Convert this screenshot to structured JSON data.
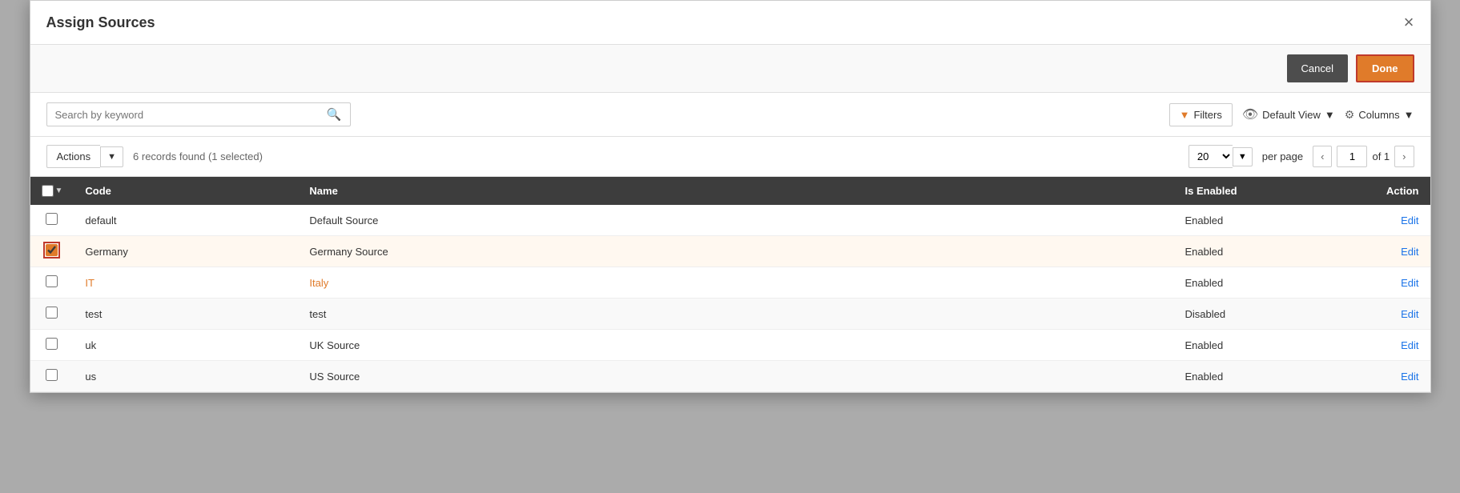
{
  "modal": {
    "title": "Assign Sources",
    "close_label": "×"
  },
  "toolbar": {
    "cancel_label": "Cancel",
    "done_label": "Done"
  },
  "search": {
    "placeholder": "Search by keyword"
  },
  "filter_bar": {
    "filters_label": "Filters",
    "view_label": "Default View",
    "columns_label": "Columns"
  },
  "actions_bar": {
    "actions_label": "Actions",
    "records_info": "6 records found (1 selected)",
    "per_page_value": "20",
    "per_page_label": "per page",
    "page_current": "1",
    "page_of": "of 1"
  },
  "table": {
    "headers": [
      "Code",
      "Name",
      "Is Enabled",
      "Action"
    ],
    "rows": [
      {
        "code": "default",
        "name": "Default Source",
        "is_enabled": "Enabled",
        "action": "Edit",
        "checked": false,
        "code_link": false
      },
      {
        "code": "Germany",
        "name": "Germany Source",
        "is_enabled": "Enabled",
        "action": "Edit",
        "checked": true,
        "code_link": false
      },
      {
        "code": "IT",
        "name": "Italy",
        "is_enabled": "Enabled",
        "action": "Edit",
        "checked": false,
        "code_link": true
      },
      {
        "code": "test",
        "name": "test",
        "is_enabled": "Disabled",
        "action": "Edit",
        "checked": false,
        "code_link": false
      },
      {
        "code": "uk",
        "name": "UK Source",
        "is_enabled": "Enabled",
        "action": "Edit",
        "checked": false,
        "code_link": false
      },
      {
        "code": "us",
        "name": "US Source",
        "is_enabled": "Enabled",
        "action": "Edit",
        "checked": false,
        "code_link": false
      }
    ]
  }
}
